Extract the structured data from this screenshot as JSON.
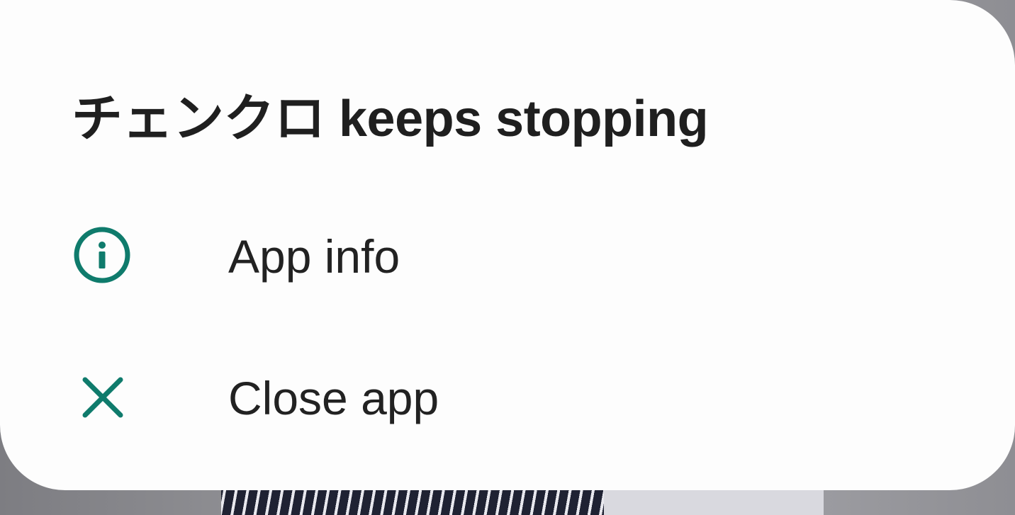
{
  "dialog": {
    "title": "チェンクロ keeps stopping",
    "items": [
      {
        "label": "App info",
        "icon": "info-icon"
      },
      {
        "label": "Close app",
        "icon": "close-icon"
      }
    ]
  },
  "colors": {
    "accent": "#0f7b6c",
    "dialog_background": "#fdfdfd",
    "text": "#222222"
  }
}
